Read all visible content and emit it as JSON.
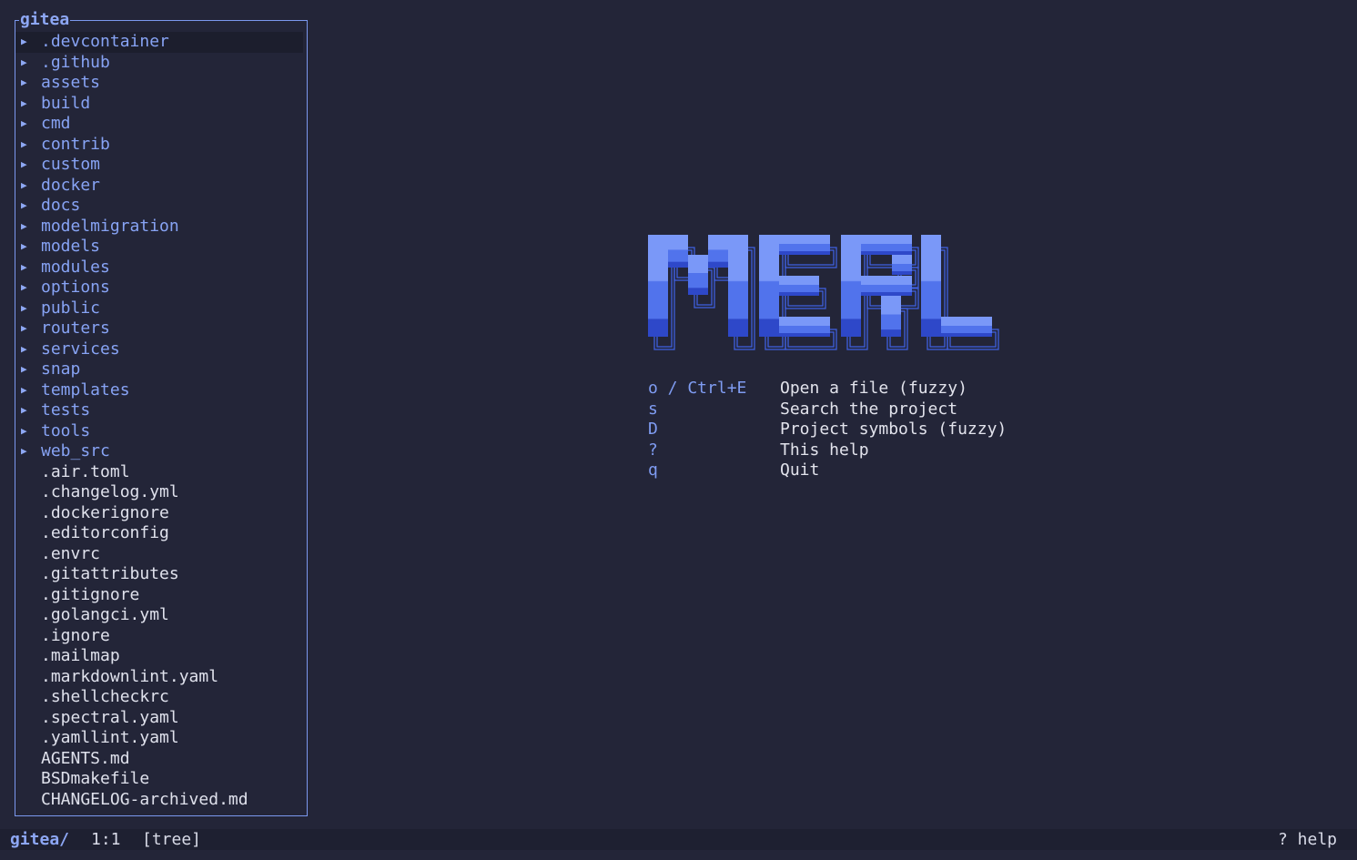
{
  "tree": {
    "title": "gitea",
    "items": [
      {
        "type": "dir",
        "name": ".devcontainer",
        "selected": true
      },
      {
        "type": "dir",
        "name": ".github"
      },
      {
        "type": "dir",
        "name": "assets"
      },
      {
        "type": "dir",
        "name": "build"
      },
      {
        "type": "dir",
        "name": "cmd"
      },
      {
        "type": "dir",
        "name": "contrib"
      },
      {
        "type": "dir",
        "name": "custom"
      },
      {
        "type": "dir",
        "name": "docker"
      },
      {
        "type": "dir",
        "name": "docs"
      },
      {
        "type": "dir",
        "name": "modelmigration"
      },
      {
        "type": "dir",
        "name": "models"
      },
      {
        "type": "dir",
        "name": "modules"
      },
      {
        "type": "dir",
        "name": "options"
      },
      {
        "type": "dir",
        "name": "public"
      },
      {
        "type": "dir",
        "name": "routers"
      },
      {
        "type": "dir",
        "name": "services"
      },
      {
        "type": "dir",
        "name": "snap"
      },
      {
        "type": "dir",
        "name": "templates"
      },
      {
        "type": "dir",
        "name": "tests"
      },
      {
        "type": "dir",
        "name": "tools"
      },
      {
        "type": "dir",
        "name": "web_src"
      },
      {
        "type": "file",
        "name": ".air.toml"
      },
      {
        "type": "file",
        "name": ".changelog.yml"
      },
      {
        "type": "file",
        "name": ".dockerignore"
      },
      {
        "type": "file",
        "name": ".editorconfig"
      },
      {
        "type": "file",
        "name": ".envrc"
      },
      {
        "type": "file",
        "name": ".gitattributes"
      },
      {
        "type": "file",
        "name": ".gitignore"
      },
      {
        "type": "file",
        "name": ".golangci.yml"
      },
      {
        "type": "file",
        "name": ".ignore"
      },
      {
        "type": "file",
        "name": ".mailmap"
      },
      {
        "type": "file",
        "name": ".markdownlint.yaml"
      },
      {
        "type": "file",
        "name": ".shellcheckrc"
      },
      {
        "type": "file",
        "name": ".spectral.yaml"
      },
      {
        "type": "file",
        "name": ".yamllint.yaml"
      },
      {
        "type": "file",
        "name": "AGENTS.md"
      },
      {
        "type": "file",
        "name": "BSDmakefile"
      },
      {
        "type": "file",
        "name": "CHANGELOG-archived.md"
      }
    ]
  },
  "logo": {
    "text": "MERL",
    "colors": {
      "top": "#7a98f8",
      "mid": "#5173ec",
      "bottom": "#2e48c9",
      "outline": "#3f5fdc"
    }
  },
  "help": [
    {
      "key": "o / Ctrl+E",
      "desc": "Open a file (fuzzy)"
    },
    {
      "key": "s",
      "desc": "Search the project"
    },
    {
      "key": "D",
      "desc": "Project symbols (fuzzy)"
    },
    {
      "key": "?",
      "desc": "This help"
    },
    {
      "key": "q",
      "desc": "Quit"
    }
  ],
  "status": {
    "path": "gitea/",
    "position": "1:1",
    "mode": "[tree]",
    "help": "? help"
  },
  "colors": {
    "background": "#232538",
    "accent": "#8da7f5",
    "status_bg": "#1e2031"
  }
}
